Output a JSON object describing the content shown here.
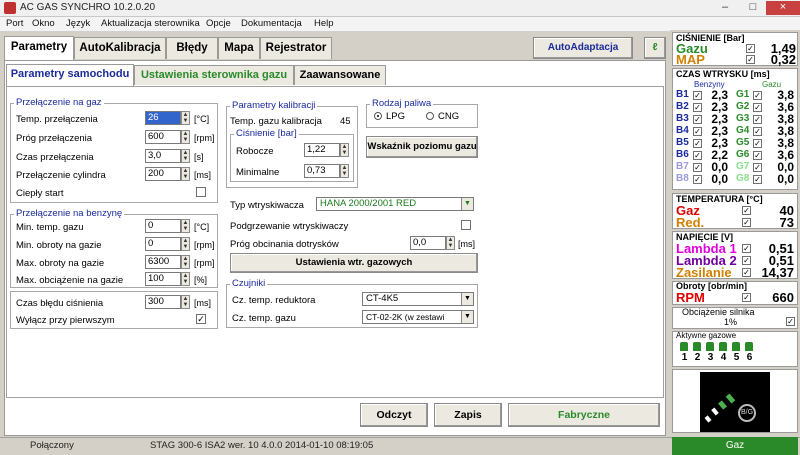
{
  "window": {
    "title": "AC GAS SYNCHRO  10.2.0.20",
    "min": "–",
    "max": "□",
    "close": "×"
  },
  "menu": [
    "Port",
    "Okno",
    "Język",
    "Aktualizacja sterownika",
    "Opcje",
    "Dokumentacja",
    "Help"
  ],
  "tabs": [
    "Parametry",
    "AutoKalibracja",
    "Błędy",
    "Mapa",
    "Rejestrator"
  ],
  "autoadaptacja": "AutoAdaptacja",
  "subtabs": [
    "Parametry samochodu",
    "Ustawienia sterownika gazu",
    "Zaawansowane"
  ],
  "gas_switch": {
    "title": "Przełączenie na gaz",
    "rows": [
      {
        "label": "Temp. przełączenia",
        "value": "26",
        "unit": "[°C]"
      },
      {
        "label": "Próg przełączenia",
        "value": "600",
        "unit": "[rpm]"
      },
      {
        "label": "Czas przełączenia",
        "value": "3,0",
        "unit": "[s]"
      },
      {
        "label": "Przełączenie cylindra",
        "value": "200",
        "unit": "[ms]"
      }
    ],
    "warm_start": "Ciepły start"
  },
  "petrol_switch": {
    "title": "Przełączenie na benzynę",
    "rows": [
      {
        "label": "Min. temp. gazu",
        "value": "0",
        "unit": "[°C]"
      },
      {
        "label": "Min. obroty na gazie",
        "value": "0",
        "unit": "[rpm]"
      },
      {
        "label": "Max. obroty na gazie",
        "value": "6300",
        "unit": "[rpm]"
      },
      {
        "label": "Max. obciążenie na gazie",
        "value": "100",
        "unit": "[%]"
      }
    ],
    "pressure_err_label": "Czas błędu ciśnienia",
    "pressure_err_value": "300",
    "pressure_err_unit": "[ms]",
    "first_off": "Wyłącz przy pierwszym",
    "first_off_checked": "✓"
  },
  "calib": {
    "title": "Parametry kalibracji",
    "gas_temp_label": "Temp. gazu kalibracja",
    "gas_temp_value": "45",
    "pressure_title": "Ciśnienie [bar]",
    "working_label": "Robocze",
    "working_value": "1,22",
    "minimal_label": "Minimalne",
    "minimal_value": "0,73"
  },
  "fuel": {
    "title": "Rodzaj paliwa",
    "lpg": "LPG",
    "cng": "CNG"
  },
  "gauge_btn": "Wskaźnik poziomu gazu",
  "injector": {
    "type_label": "Typ wtryskiwacza",
    "type_value": "HANA 2000/2001 RED",
    "preheat_label": "Podgrzewanie wtryskiwaczy",
    "cut_label": "Próg obcinania dotrysków",
    "cut_value": "0,0",
    "cut_unit": "[ms]",
    "settings_btn": "Ustawienia wtr. gazowych"
  },
  "sensors": {
    "title": "Czujniki",
    "reducer_label": "Cz. temp. reduktora",
    "reducer_value": "CT-4K5",
    "gas_label": "Cz. temp. gazu",
    "gas_value": "CT-02-2K (w zestawi"
  },
  "buttons": {
    "read": "Odczyt",
    "write": "Zapis",
    "factory": "Fabryczne"
  },
  "right": {
    "pressure_title": "CIŚNIENIE [Bar]",
    "gaz_label": "Gazu",
    "gaz_value": "1,49",
    "map_label": "MAP",
    "map_value": "0,32",
    "inj_title": "CZAS WTRYSKU  [ms]",
    "benzyny": "Benzyny",
    "gazu": "Gazu",
    "b": [
      {
        "n": "B1",
        "v": "2,3"
      },
      {
        "n": "B2",
        "v": "2,3"
      },
      {
        "n": "B3",
        "v": "2,3"
      },
      {
        "n": "B4",
        "v": "2,3"
      },
      {
        "n": "B5",
        "v": "2,3"
      },
      {
        "n": "B6",
        "v": "2,2"
      },
      {
        "n": "B7",
        "v": "0,0"
      },
      {
        "n": "B8",
        "v": "0,0"
      }
    ],
    "g": [
      {
        "n": "G1",
        "v": "3,8"
      },
      {
        "n": "G2",
        "v": "3,6"
      },
      {
        "n": "G3",
        "v": "3,8"
      },
      {
        "n": "G4",
        "v": "3,8"
      },
      {
        "n": "G5",
        "v": "3,8"
      },
      {
        "n": "G6",
        "v": "3,6"
      },
      {
        "n": "G7",
        "v": "0,0"
      },
      {
        "n": "G8",
        "v": "0,0"
      }
    ],
    "temp_title": "TEMPERATURA  [°C]",
    "temp_gaz_label": "Gaz",
    "temp_gaz_value": "40",
    "temp_red_label": "Red.",
    "temp_red_value": "73",
    "volt_title": "NAPIĘCIE [V]",
    "lambda1_label": "Lambda 1",
    "lambda1_value": "0,51",
    "lambda2_label": "Lambda 2",
    "lambda2_value": "0,51",
    "supply_label": "Zasilanie",
    "supply_value": "14,37",
    "rpm_title": "Obroty [obr/min]",
    "rpm_label": "RPM",
    "rpm_value": "660",
    "load_title": "Obciążenie silnika",
    "load_value": "1%",
    "active_title": "Aktywne gazowe",
    "cyl": [
      "1",
      "2",
      "3",
      "4",
      "5",
      "6"
    ],
    "bg": "B/G",
    "mode": "Gaz"
  },
  "status": {
    "conn": "Połączony",
    "info": "STAG 300-6 ISA2  wer. 10  4.0.0    2014-01-10 08:19:05"
  },
  "colors": {
    "accent": "#1a2a9a",
    "green": "#2a8a2a",
    "red": "#e00000",
    "magenta": "#e000e0",
    "purple": "#7000a0",
    "amber": "#d08000"
  }
}
